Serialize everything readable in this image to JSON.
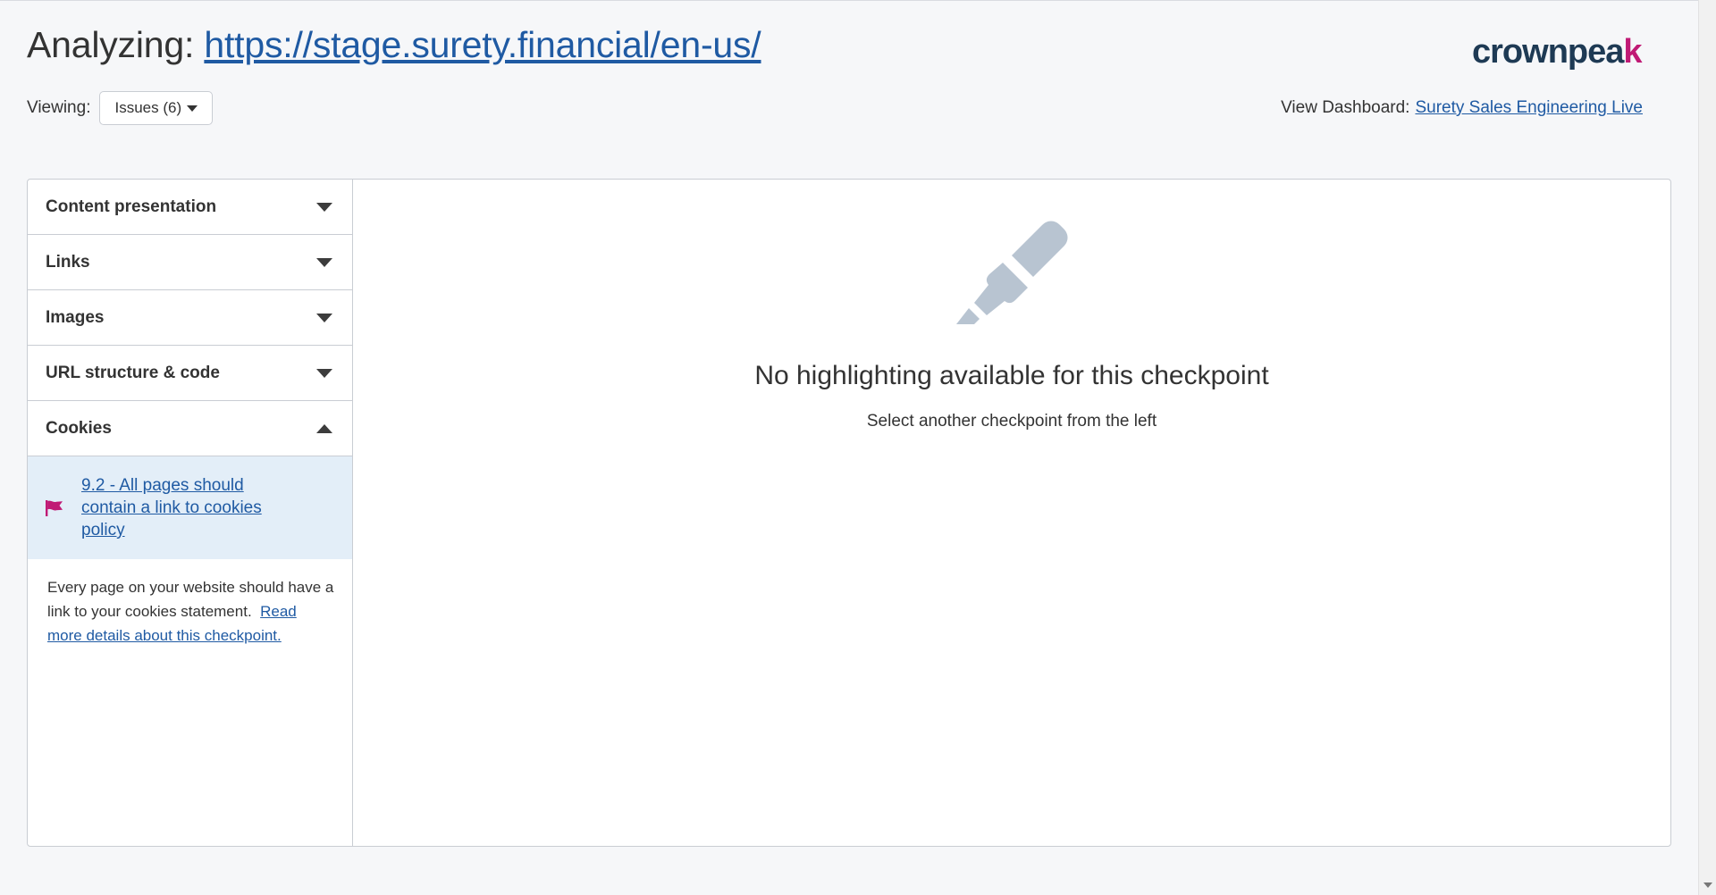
{
  "header": {
    "analyzing_label": "Analyzing:",
    "url": "https://stage.surety.financial/en-us/",
    "logo_main": "crownpea",
    "logo_accent": "k"
  },
  "viewing": {
    "label": "Viewing:",
    "selected": "Issues (6)"
  },
  "dashboard": {
    "label": "View Dashboard:",
    "link": "Surety Sales Engineering Live"
  },
  "sidebar": {
    "sections": [
      {
        "label": "Content presentation",
        "expanded": false
      },
      {
        "label": "Links",
        "expanded": false
      },
      {
        "label": "Images",
        "expanded": false
      },
      {
        "label": "URL structure & code",
        "expanded": false
      },
      {
        "label": "Cookies",
        "expanded": true
      }
    ],
    "checkpoint": {
      "label": "9.2 - All pages should contain a link to cookies policy",
      "flag_color": "#c01a75"
    },
    "description": {
      "text": "Every page on your website should have a link to your cookies statement.",
      "link": "Read more details about this checkpoint."
    }
  },
  "main": {
    "icon": "highlighter-icon",
    "icon_color": "#b8c4d1",
    "message": "No highlighting available for this checkpoint",
    "subtext": "Select another checkpoint from the left"
  }
}
